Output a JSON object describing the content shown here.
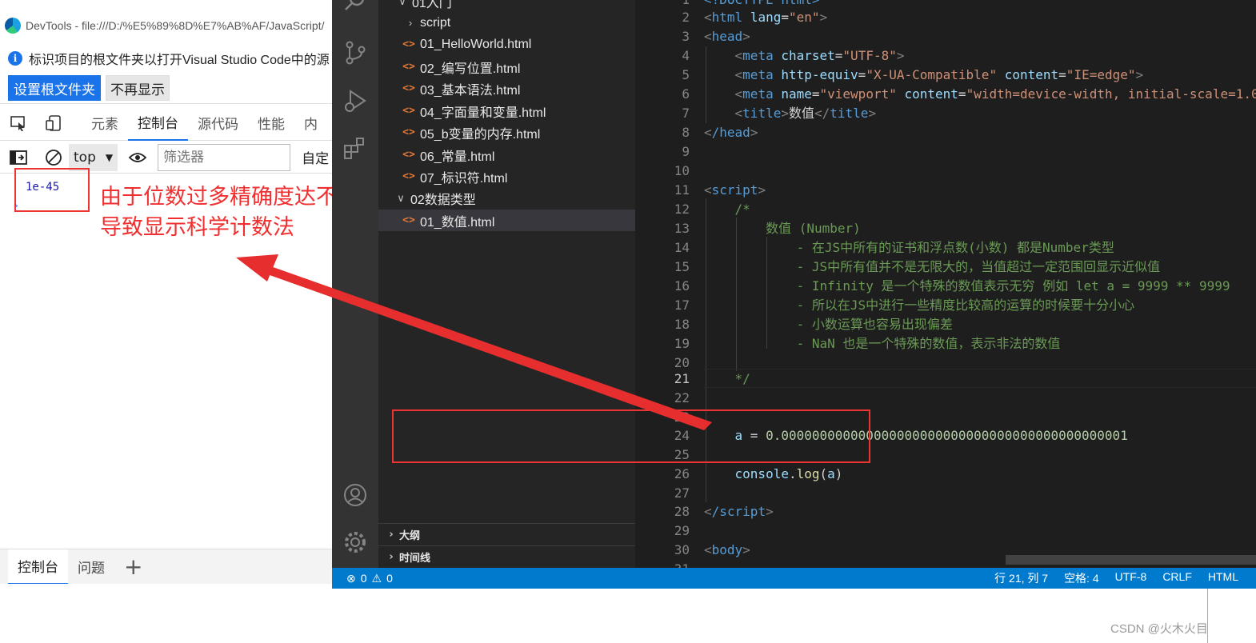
{
  "devtools": {
    "title": "DevTools - file:///D:/%E5%89%8D%E7%AB%AF/JavaScript/",
    "infobar": {
      "message": "标识项目的根文件夹以打开Visual Studio Code中的源",
      "primary_button": "设置根文件夹",
      "secondary_button": "不再显示"
    },
    "tabs": [
      "元素",
      "控制台",
      "源代码",
      "性能",
      "内"
    ],
    "active_tab": "控制台",
    "toolbar": {
      "context": "top",
      "filter_placeholder": "筛选器",
      "levels": "自定"
    },
    "console_output": "1e-45",
    "drawer": {
      "tabs": [
        "控制台",
        "问题"
      ],
      "add": "+"
    }
  },
  "annotation": {
    "lines": [
      "由于位数过多精确度达不到",
      "导致显示科学计数法"
    ],
    "color": "#f03030"
  },
  "explorer": {
    "folder_top": "01入门",
    "items": [
      {
        "label": "script",
        "kind": "folder"
      },
      {
        "label": "01_HelloWorld.html",
        "kind": "html"
      },
      {
        "label": "02_编写位置.html",
        "kind": "html"
      },
      {
        "label": "03_基本语法.html",
        "kind": "html"
      },
      {
        "label": "04_字面量和变量.html",
        "kind": "html"
      },
      {
        "label": "05_b变量的内存.html",
        "kind": "html"
      },
      {
        "label": "06_常量.html",
        "kind": "html"
      },
      {
        "label": "07_标识符.html",
        "kind": "html"
      },
      {
        "label": "02数据类型",
        "kind": "folder-open"
      },
      {
        "label": "01_数值.html",
        "kind": "html",
        "selected": true
      }
    ],
    "outline": "大纲",
    "timeline": "时间线"
  },
  "editor": {
    "current_line": 21,
    "line_numbers": [
      "1",
      "2",
      "3",
      "4",
      "5",
      "6",
      "7",
      "8",
      "9",
      "10",
      "11",
      "12",
      "13",
      "14",
      "15",
      "16",
      "17",
      "18",
      "19",
      "20",
      "21",
      "22",
      "23",
      "24",
      "25",
      "26",
      "27",
      "28",
      "29",
      "30",
      "31"
    ],
    "code": {
      "l1": "<!DOCTYPE html>",
      "l2_tag": "html",
      "l2_attr": "lang",
      "l2_val": "\"en\"",
      "l3_tag": "head",
      "l4_tag": "meta",
      "l4_attr": "charset",
      "l4_val": "\"UTF-8\"",
      "l5_tag": "meta",
      "l5_attr1": "http-equiv",
      "l5_val1": "\"X-UA-Compatible\"",
      "l5_attr2": "content",
      "l5_val2": "\"IE=edge\"",
      "l6_tag": "meta",
      "l6_attr1": "name",
      "l6_val1": "\"viewport\"",
      "l6_attr2": "content",
      "l6_val2": "\"width=device-width, initial-scale=1.0\"",
      "l7_tag": "title",
      "l7_text": "数值",
      "l8_tag": "/head",
      "l11_tag": "script",
      "l12": "/*",
      "l13": "数值 (Number)",
      "l14": "- 在JS中所有的证书和浮点数(小数) 都是Number类型",
      "l15": "- JS中所有值并不是无限大的，当值超过一定范围回显示近似值",
      "l16": "- Infinity 是一个特殊的数值表示无穷 例如 let a = 9999 ** 9999",
      "l17": "- 所以在JS中进行一些精度比较高的运算的时候要十分小心",
      "l18": "- 小数运算也容易出现偏差",
      "l19": "- NaN 也是一个特殊的数值，表示非法的数值",
      "l21": "*/",
      "l24_var": "a",
      "l24_op": " = ",
      "l24_num": "0.000000000000000000000000000000000000000000001",
      "l26_obj": "console",
      "l26_fn": "log",
      "l26_arg": "a",
      "l28_tag": "/script",
      "l30_tag": "body"
    }
  },
  "statusbar": {
    "errors": "0",
    "warnings": "0",
    "position": "行 21, 列 7",
    "spaces": "空格: 4",
    "encoding": "UTF-8",
    "eol": "CRLF",
    "language": "HTML"
  },
  "watermark": "CSDN @火木火目"
}
